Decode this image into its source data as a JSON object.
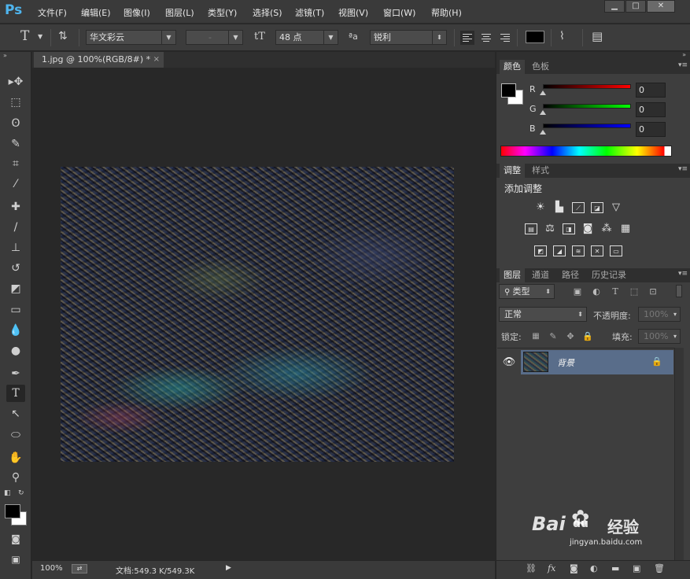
{
  "app": {
    "logo": "Ps"
  },
  "menu": {
    "items": [
      "文件(F)",
      "编辑(E)",
      "图像(I)",
      "图层(L)",
      "类型(Y)",
      "选择(S)",
      "滤镜(T)",
      "视图(V)",
      "窗口(W)",
      "帮助(H)"
    ]
  },
  "window_controls": {
    "minimize": "▁",
    "maximize": "□",
    "close": "✕"
  },
  "options": {
    "tool_glyph": "T",
    "font_family": "华文彩云",
    "font_style": "-",
    "size_glyph": "tT",
    "font_size": "48 点",
    "aa_glyph": "ªa",
    "antialias": "锐利",
    "text_color": "#000000"
  },
  "document": {
    "tab_title": "1.jpg @ 100%(RGB/8#) *",
    "tab_close": "×",
    "zoom": "100%",
    "doc_info": "文档:549.3 K/549.3K"
  },
  "color_panel": {
    "tabs": [
      "颜色",
      "色板"
    ],
    "channels": [
      {
        "label": "R",
        "value": "0",
        "color": "#ff0000"
      },
      {
        "label": "G",
        "value": "0",
        "color": "#00ff00"
      },
      {
        "label": "B",
        "value": "0",
        "color": "#0000ff"
      }
    ],
    "foreground": "#000000",
    "background": "#ffffff"
  },
  "adjustments_panel": {
    "tabs": [
      "调整",
      "样式"
    ],
    "title": "添加调整"
  },
  "layers_panel": {
    "tabs": [
      "图层",
      "通道",
      "路径",
      "历史记录"
    ],
    "filter_kind": "类型",
    "blend_mode": "正常",
    "opacity_label": "不透明度:",
    "opacity_value": "100%",
    "lock_label": "锁定:",
    "fill_label": "填充:",
    "fill_value": "100%",
    "layers": [
      {
        "name": "背景",
        "visible": true,
        "locked": true
      }
    ]
  },
  "watermark": {
    "brand": "Bai",
    "paw": "du",
    "cn": "经验",
    "url": "jingyan.baidu.com"
  }
}
